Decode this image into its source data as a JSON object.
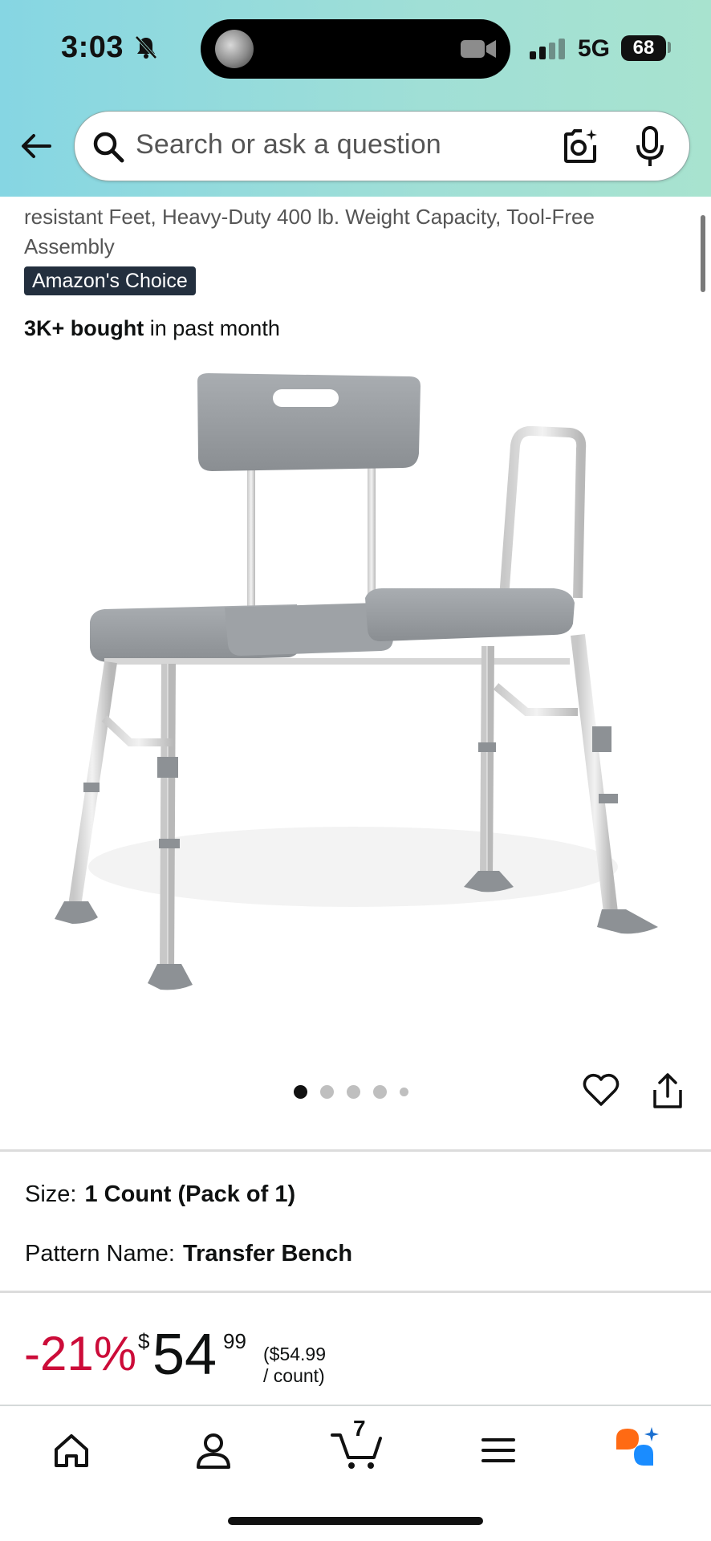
{
  "status_bar": {
    "time": "3:03",
    "network": "5G",
    "battery": "68"
  },
  "search": {
    "placeholder": "Search or ask a question"
  },
  "product": {
    "title_tail": "resistant Feet, Heavy-Duty 400 lb. Weight Capacity, Tool-Free Assembly",
    "badge": "Amazon's Choice",
    "bought_bold": "3K+ bought",
    "bought_rest": " in past month",
    "image_carousel": {
      "total_images": 5,
      "active_index": 0
    }
  },
  "variations": {
    "size_label": "Size:",
    "size_value": "1 Count (Pack of 1)",
    "pattern_label": "Pattern Name:",
    "pattern_value": "Transfer Bench"
  },
  "price": {
    "discount": "-21%",
    "currency": "$",
    "whole": "54",
    "fraction": "99",
    "unit_price": "($54.99 / count)"
  },
  "bottom_nav": {
    "cart_count": "7",
    "items": [
      "home",
      "account",
      "cart",
      "menu",
      "rufus"
    ]
  },
  "colors": {
    "header_gradient_start": "#86d6e3",
    "header_gradient_end": "#a8e3cf",
    "discount_red": "#cc0c39",
    "badge_bg": "#232f3e",
    "rufus_orange": "#ff6a13",
    "rufus_blue": "#1a8cff"
  }
}
